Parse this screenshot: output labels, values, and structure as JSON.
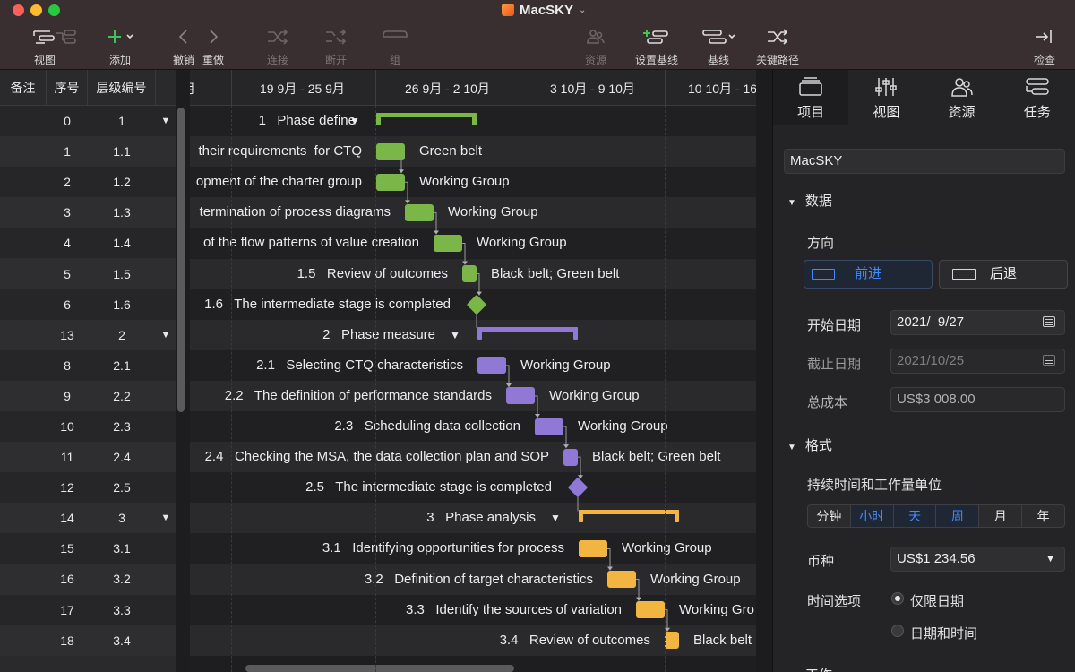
{
  "window": {
    "title": "MacSKY"
  },
  "toolbar": {
    "view": "视图",
    "add": "添加",
    "undo": "撤销",
    "redo": "重做",
    "link": "连接",
    "unlink": "断开",
    "group": "组",
    "resources": "资源",
    "set_baseline": "设置基线",
    "baseline": "基线",
    "critical_path": "关键路径",
    "inspect": "检查"
  },
  "table": {
    "headers": {
      "note": "备注",
      "no": "序号",
      "wbs": "层级编号"
    },
    "rows": [
      {
        "no": "0",
        "wbs": "1",
        "toggle": "▼"
      },
      {
        "no": "1",
        "wbs": "1.1",
        "toggle": ""
      },
      {
        "no": "2",
        "wbs": "1.2",
        "toggle": ""
      },
      {
        "no": "3",
        "wbs": "1.3",
        "toggle": ""
      },
      {
        "no": "4",
        "wbs": "1.4",
        "toggle": ""
      },
      {
        "no": "5",
        "wbs": "1.5",
        "toggle": ""
      },
      {
        "no": "6",
        "wbs": "1.6",
        "toggle": ""
      },
      {
        "no": "13",
        "wbs": "2",
        "toggle": "▼"
      },
      {
        "no": "8",
        "wbs": "2.1",
        "toggle": ""
      },
      {
        "no": "9",
        "wbs": "2.2",
        "toggle": ""
      },
      {
        "no": "10",
        "wbs": "2.3",
        "toggle": ""
      },
      {
        "no": "11",
        "wbs": "2.4",
        "toggle": ""
      },
      {
        "no": "12",
        "wbs": "2.5",
        "toggle": ""
      },
      {
        "no": "14",
        "wbs": "3",
        "toggle": "▼"
      },
      {
        "no": "15",
        "wbs": "3.1",
        "toggle": ""
      },
      {
        "no": "16",
        "wbs": "3.2",
        "toggle": ""
      },
      {
        "no": "17",
        "wbs": "3.3",
        "toggle": ""
      },
      {
        "no": "18",
        "wbs": "3.4",
        "toggle": ""
      }
    ]
  },
  "gantt": {
    "weeks": [
      "月",
      "19 9月 - 25 9月",
      "26 9月 - 2 10月",
      "3 10月 - 9 10月",
      "10 10月 - 16 10月"
    ],
    "colors": {
      "phase1": "#7ab648",
      "phase2": "#8f78d6",
      "phase3": "#f2b541"
    },
    "rows": [
      {
        "label": "1   Phase define",
        "toggle": "▼",
        "resource": ""
      },
      {
        "label": "their requirements  for CTQ",
        "resource": "Green belt"
      },
      {
        "label": "opment of the charter group",
        "resource": "Working Group"
      },
      {
        "label": "termination of process diagrams",
        "resource": "Working Group"
      },
      {
        "label": "of the flow patterns of value creation",
        "resource": "Working Group"
      },
      {
        "label": "1.5   Review of outcomes",
        "resource": "Black belt; Green belt"
      },
      {
        "label": "1.6   The intermediate stage is completed",
        "resource": ""
      },
      {
        "label": "2   Phase measure",
        "toggle": "▼",
        "resource": ""
      },
      {
        "label": "2.1   Selecting CTQ characteristics",
        "resource": "Working Group"
      },
      {
        "label": "2.2   The definition of performance standards",
        "resource": "Working Group"
      },
      {
        "label": "2.3   Scheduling data collection",
        "resource": "Working Group"
      },
      {
        "label": "2.4   Checking the MSA, the data collection plan and SOP",
        "resource": "Black belt; Green belt"
      },
      {
        "label": "2.5   The intermediate stage is completed",
        "resource": ""
      },
      {
        "label": "3   Phase analysis",
        "toggle": "▼",
        "resource": ""
      },
      {
        "label": "3.1   Identifying opportunities for process",
        "resource": "Working Group"
      },
      {
        "label": "3.2   Definition of target characteristics",
        "resource": "Working Group"
      },
      {
        "label": "3.3   Identify the sources of variation",
        "resource": "Working Gro"
      },
      {
        "label": "3.4   Review of outcomes",
        "resource": "Black belt"
      }
    ]
  },
  "inspector": {
    "tabs": [
      "项目",
      "视图",
      "资源",
      "任务"
    ],
    "project_name": "MacSKY",
    "section_data": "数据",
    "direction_label": "方向",
    "forward": "前进",
    "backward": "后退",
    "start_label": "开始日期",
    "start_value": "2021/  9/27",
    "end_label": "截止日期",
    "end_value": "2021/10/25",
    "cost_label": "总成本",
    "cost_value": "US$3 008.00",
    "section_format": "格式",
    "duration_unit_label": "持续时间和工作量单位",
    "units": [
      "分钟",
      "小时",
      "天",
      "周",
      "月",
      "年"
    ],
    "currency_label": "币种",
    "currency_value": "US$1 234.56",
    "time_option_label": "时间选项",
    "time_option_date": "仅限日期",
    "time_option_datetime": "日期和时间",
    "section_work": "工作"
  }
}
